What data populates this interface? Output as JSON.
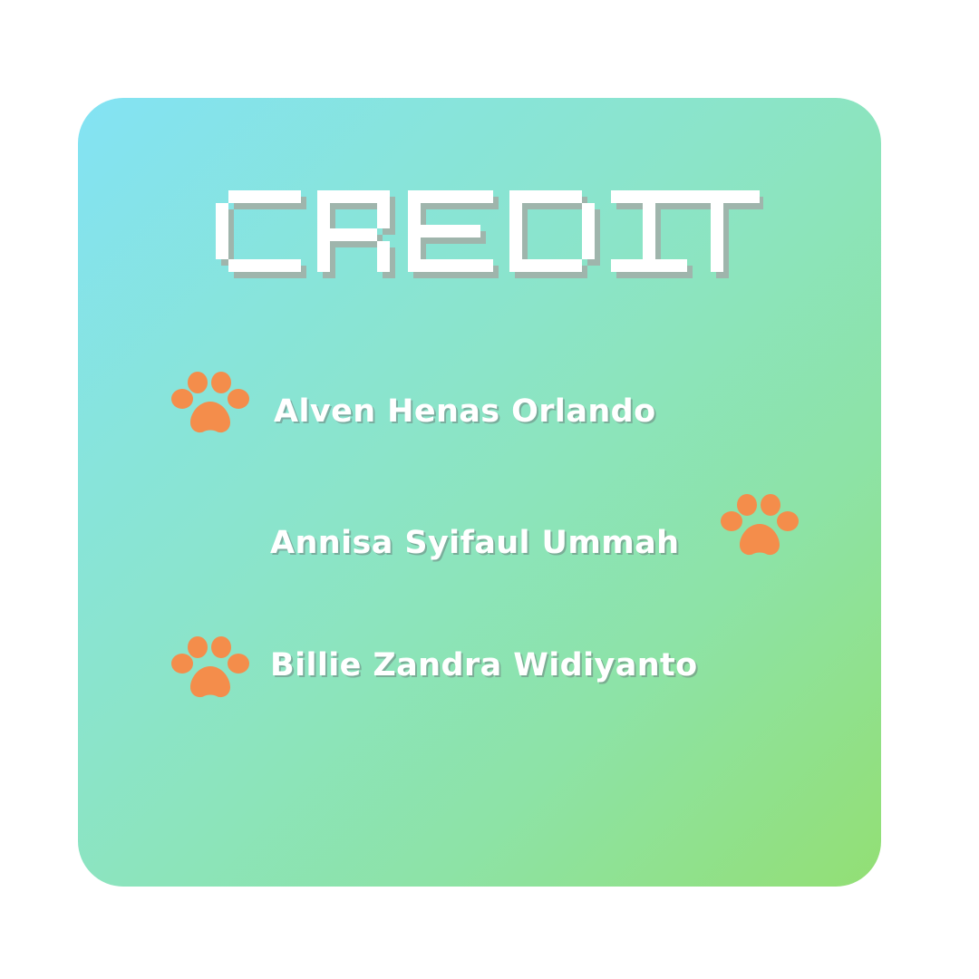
{
  "title": "CREDIT",
  "colors": {
    "gradient_start": "#83e3f4",
    "gradient_end": "#93df74",
    "paw": "#f48d4b",
    "text": "#ffffff"
  },
  "credits": [
    {
      "name": "Alven Henas Orlando",
      "icon": "paw-print-icon"
    },
    {
      "name": "Annisa Syifaul Ummah",
      "icon": "paw-print-icon"
    },
    {
      "name": "Billie Zandra Widiyanto",
      "icon": "paw-print-icon"
    }
  ]
}
